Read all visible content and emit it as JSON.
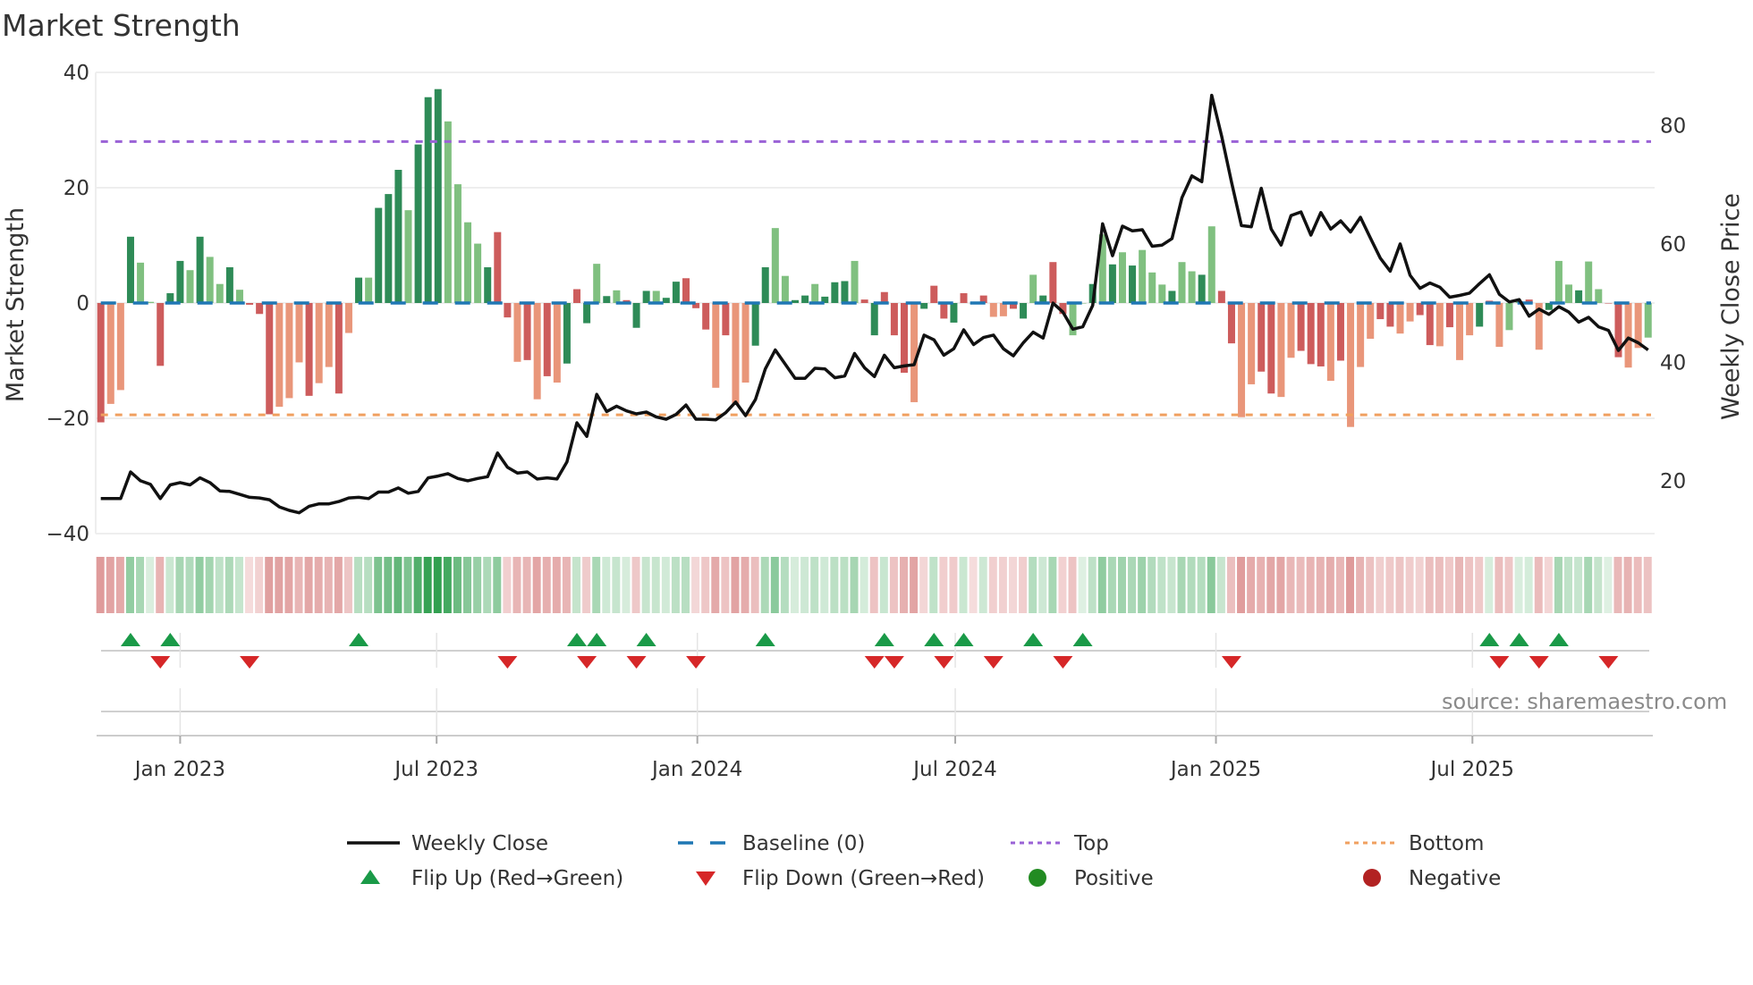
{
  "chart_data": {
    "type": "bar",
    "title": "Market Strength",
    "ylabel": "Market Strength",
    "ylabel_right": "Weekly Close Price",
    "ylim": [
      -40,
      40
    ],
    "ylim_right": [
      11,
      89
    ],
    "yticks": [
      40,
      20,
      0,
      -20,
      -40
    ],
    "yticks_right": [
      80,
      60,
      40,
      20
    ],
    "x_start_week": "2022-11-06",
    "x_interval": "weekly",
    "xticks": [
      {
        "date": "2023-01-01",
        "label": "Jan 2023"
      },
      {
        "date": "2023-07-01",
        "label": "Jul 2023"
      },
      {
        "date": "2024-01-01",
        "label": "Jan 2024"
      },
      {
        "date": "2024-07-01",
        "label": "Jul 2024"
      },
      {
        "date": "2025-01-01",
        "label": "Jan 2025"
      },
      {
        "date": "2025-07-01",
        "label": "Jul 2025"
      }
    ],
    "top_level": 28,
    "bottom_level": -19.4,
    "baseline": 0,
    "strength": [
      -20.7,
      -17.5,
      -15.1,
      11.5,
      7.0,
      0.2,
      -10.9,
      1.7,
      7.3,
      5.7,
      11.5,
      8.0,
      3.3,
      6.2,
      2.3,
      -0.3,
      -1.9,
      -19.3,
      -18.0,
      -16.5,
      -10.3,
      -16.1,
      -13.9,
      -11.1,
      -15.7,
      -5.2,
      4.4,
      4.4,
      16.5,
      18.9,
      23.1,
      16.1,
      27.5,
      35.7,
      37.1,
      31.5,
      20.6,
      14.0,
      10.3,
      6.2,
      12.3,
      -2.5,
      -10.2,
      -9.9,
      -16.7,
      -12.7,
      -13.8,
      -10.5,
      2.4,
      -3.5,
      6.8,
      1.2,
      2.2,
      0.5,
      -4.3,
      2.1,
      2.1,
      0.9,
      3.7,
      4.3,
      -0.9,
      -4.6,
      -14.7,
      -5.6,
      -17.5,
      -13.8,
      -7.4,
      6.2,
      13.0,
      4.7,
      0.5,
      1.3,
      3.3,
      1.1,
      3.6,
      3.8,
      7.3,
      0.6,
      -5.6,
      1.9,
      -5.6,
      -12.1,
      -17.2,
      -1.0,
      3.0,
      -2.7,
      -3.4,
      1.7,
      -0.1,
      1.3,
      -2.4,
      -2.3,
      -1.0,
      -2.7,
      4.9,
      1.3,
      7.1,
      -1.9,
      -5.6,
      0.0,
      3.3,
      11.9,
      6.7,
      8.8,
      6.5,
      9.2,
      5.3,
      3.2,
      2.1,
      7.1,
      5.5,
      4.9,
      13.3,
      2.1,
      -7.0,
      -19.8,
      -14.1,
      -11.9,
      -15.7,
      -16.3,
      -9.5,
      -8.3,
      -10.6,
      -11.0,
      -13.5,
      -10.0,
      -21.5,
      -11.1,
      -6.2,
      -2.8,
      -4.1,
      -5.3,
      -3.2,
      -2.1,
      -7.3,
      -7.5,
      -4.2,
      -9.9,
      -5.6,
      -4.1,
      0.4,
      -7.6,
      -4.7,
      0.3,
      0.6,
      -8.1,
      -1.2,
      7.3,
      3.2,
      2.2,
      7.2,
      2.4,
      0.0,
      -9.4,
      -11.2,
      -7.8,
      -6.0
    ],
    "bar_shade": "RrrGggRGGgGggGgRRRrrrRrrRrGgGGGgGGGggggGRRrRrRrGRGgGgRGGgGGRRRrRrrGGggGGgGGGgRGRRRrGRRGRGRrrRGgGRRggGgGgGgggGggGgRRrrRRrrRRRrRrrrRRrrRRrRrrGRrggRrGggGggRRrr",
    "weekly_close": [
      17.0,
      17.0,
      17.0,
      21.5,
      20.0,
      19.4,
      17.0,
      19.3,
      19.7,
      19.3,
      20.5,
      19.7,
      18.3,
      18.2,
      17.7,
      17.2,
      17.1,
      16.8,
      15.6,
      15.0,
      14.6,
      15.7,
      16.1,
      16.1,
      16.5,
      17.1,
      17.2,
      17.0,
      18.1,
      18.1,
      18.8,
      17.9,
      18.2,
      20.5,
      20.8,
      21.2,
      20.4,
      20.0,
      20.4,
      20.7,
      24.7,
      22.3,
      21.3,
      21.5,
      20.3,
      20.5,
      20.3,
      23.2,
      29.8,
      27.5,
      34.6,
      31.7,
      32.6,
      31.8,
      31.3,
      31.6,
      30.8,
      30.4,
      31.2,
      32.8,
      30.4,
      30.4,
      30.3,
      31.5,
      33.3,
      31.0,
      33.7,
      38.9,
      42.1,
      39.7,
      37.3,
      37.3,
      39.0,
      38.9,
      37.4,
      37.7,
      41.5,
      39.1,
      37.6,
      41.2,
      39.1,
      39.4,
      39.6,
      44.6,
      43.8,
      41.2,
      42.3,
      45.5,
      43.0,
      44.2,
      44.6,
      42.3,
      41.1,
      43.3,
      45.1,
      44.1,
      50.0,
      48.5,
      45.6,
      46.0,
      49.6,
      63.4,
      58.0,
      63.0,
      62.2,
      62.4,
      59.6,
      59.8,
      60.9,
      67.8,
      71.5,
      70.5,
      85.1,
      78.2,
      70.4,
      63.1,
      62.9,
      69.4,
      62.5,
      59.8,
      64.8,
      65.4,
      61.5,
      65.3,
      62.5,
      63.9,
      62.0,
      64.5,
      61.0,
      57.6,
      55.4,
      60.0,
      54.7,
      52.5,
      53.4,
      52.7,
      51.0,
      51.3,
      51.7,
      53.3,
      54.8,
      51.5,
      50.2,
      50.6,
      47.8,
      49.0,
      48.1,
      49.4,
      48.5,
      46.8,
      47.6,
      46.0,
      45.4,
      42.0,
      44.1,
      43.3,
      42.1
    ],
    "flip_up_weeks": [
      4,
      8,
      27,
      49,
      51,
      56,
      68,
      80,
      85,
      88,
      95,
      100,
      141,
      144,
      148
    ],
    "flip_down_weeks": [
      7,
      16,
      42,
      50,
      55,
      61,
      79,
      81,
      86,
      91,
      98,
      115,
      142,
      146,
      153
    ],
    "legend": {
      "placement": "bottom",
      "entries": [
        {
          "label": "Weekly Close",
          "symbol": "line"
        },
        {
          "label": "Baseline (0)",
          "symbol": "dashed-line"
        },
        {
          "label": "Top",
          "symbol": "dotted-line"
        },
        {
          "label": "Bottom",
          "symbol": "dotted-line"
        },
        {
          "label": "Flip Up (Red→Green)",
          "symbol": "triangle-up"
        },
        {
          "label": "Flip Down (Green→Red)",
          "symbol": "triangle-down"
        },
        {
          "label": "Positive",
          "symbol": "circle"
        },
        {
          "label": "Negative",
          "symbol": "circle"
        }
      ]
    },
    "source": "source: sharemaestro.com"
  },
  "colors": {
    "bar_dark_green": "#2e8b57",
    "bar_light_green": "#80c080",
    "bar_dark_red": "#cd5c5c",
    "bar_light_red": "#e9967a",
    "baseline": "#1f77b4",
    "top": "#9a62d6",
    "bottom": "#f0a060",
    "price": "#111111",
    "flip_up": "#1a9a48",
    "flip_down": "#d62728",
    "positive": "#228b22",
    "negative": "#b22222"
  }
}
